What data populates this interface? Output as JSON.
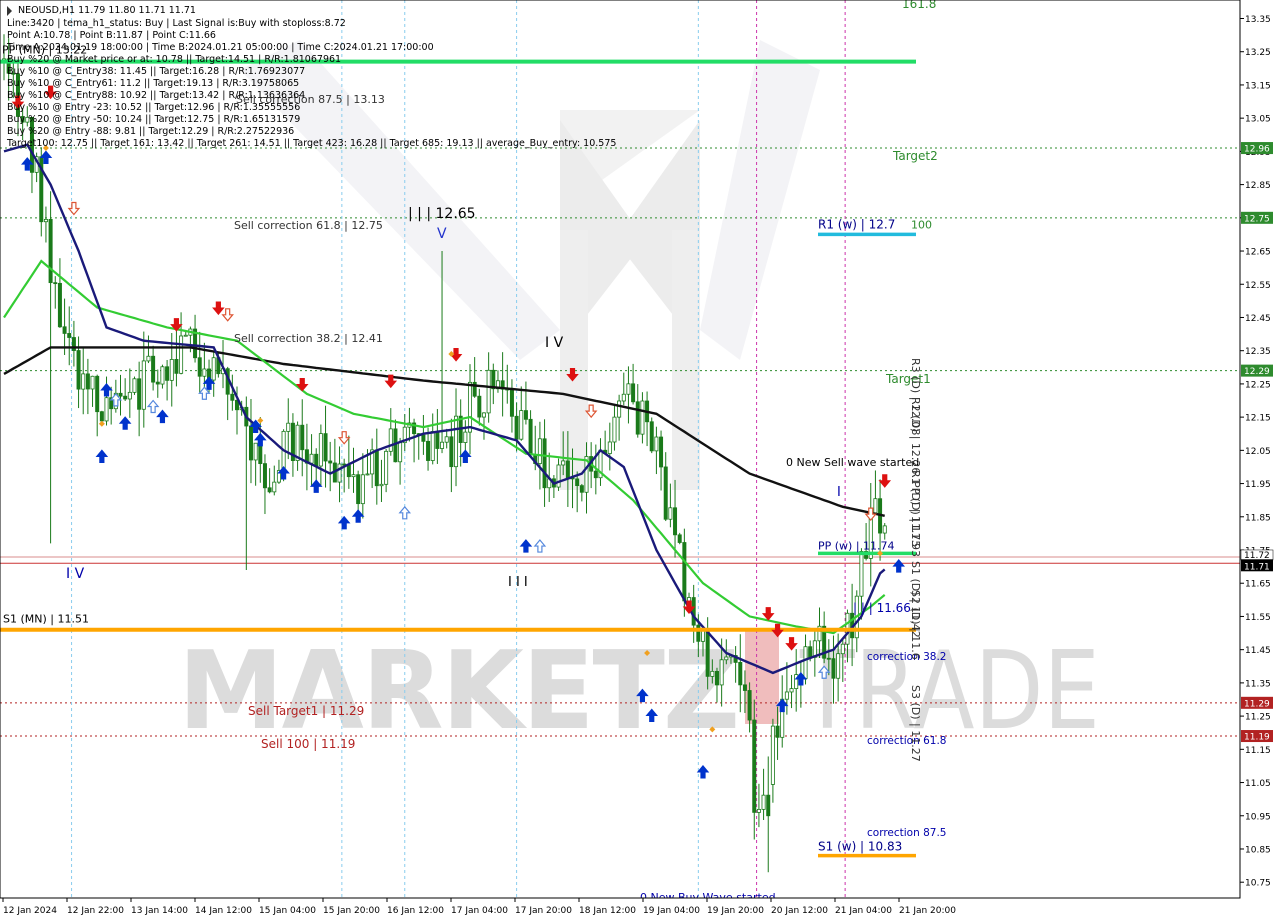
{
  "chart_data": {
    "type": "candlestick",
    "symbol_header": "NEOUSD,H1  11.79 11.80 11.71 11.71",
    "info_lines": [
      "Line:3420 | tema_h1_status: Buy | Last Signal is:Buy with stoploss:8.72",
      "Point A:10.78 | Point B:11.87 | Point C:11.66",
      "Time A:2024.01.19 18:00:00 | Time B:2024.01.21 05:00:00 | Time C:2024.01.21 17:00:00",
      "Buy %20 @ Market price or at: 10.78 || Target:14.51 | R/R:1.81067961",
      "Buy %10 @ C_Entry38: 11.45 || Target:16.28 | R/R:1.76923077",
      "Buy %10 @ C_Entry61: 11.2 || Target:19.13 | R/R:3.19758065",
      "Buy %10 @ C_Entry88: 10.92 || Target:13.42 | R/R:1.13636364",
      "Buy %10 @ Entry -23: 10.52 || Target:12.96 | R/R:1.35555556",
      "Buy %20 @ Entry -50: 10.24 || Target:12.75 | R/R:1.65131579",
      "Buy %20 @ Entry -88: 9.81 || Target:12.29 | R/R:2.27522936",
      "Target100: 12.75 || Target 161: 13.42 || Target 261: 14.51 || Target 423: 16.28 || Target 685: 19.13 || average_Buy_entry: 10.575"
    ],
    "y_range": [
      10.72,
      13.4
    ],
    "y_ticks": [
      "13.35",
      "13.25",
      "13.15",
      "13.05",
      "12.95",
      "12.85",
      "12.75",
      "12.65",
      "12.55",
      "12.45",
      "12.35",
      "12.25",
      "12.15",
      "12.05",
      "11.95",
      "11.85",
      "11.75",
      "11.65",
      "11.55",
      "11.45",
      "11.35",
      "11.25",
      "11.15",
      "11.05",
      "10.95",
      "10.85",
      "10.75"
    ],
    "x_labels": [
      "12 Jan 2024",
      "12 Jan 22:00",
      "13 Jan 14:00",
      "14 Jan 12:00",
      "15 Jan 04:00",
      "15 Jan 20:00",
      "16 Jan 12:00",
      "17 Jan 04:00",
      "17 Jan 20:00",
      "18 Jan 12:00",
      "19 Jan 04:00",
      "19 Jan 20:00",
      "20 Jan 12:00",
      "21 Jan 04:00",
      "21 Jan 20:00"
    ],
    "candle_count": 190,
    "anchor_prices": [
      [
        0,
        13.22
      ],
      [
        6,
        13.05
      ],
      [
        12,
        12.55
      ],
      [
        18,
        12.25
      ],
      [
        25,
        12.15
      ],
      [
        33,
        12.3
      ],
      [
        43,
        12.35
      ],
      [
        48,
        12.32
      ],
      [
        52,
        12.1
      ],
      [
        58,
        11.98
      ],
      [
        64,
        12.1
      ],
      [
        68,
        12.05
      ],
      [
        76,
        11.95
      ],
      [
        84,
        12.05
      ],
      [
        90,
        12.12
      ],
      [
        96,
        12.05
      ],
      [
        102,
        12.2
      ],
      [
        108,
        12.3
      ],
      [
        112,
        12.1
      ],
      [
        118,
        11.98
      ],
      [
        124,
        11.92
      ],
      [
        128,
        12.0
      ],
      [
        134,
        12.25
      ],
      [
        140,
        12.1
      ],
      [
        146,
        11.7
      ],
      [
        151,
        11.45
      ],
      [
        156,
        11.4
      ],
      [
        160,
        11.3
      ],
      [
        163,
        10.9
      ],
      [
        166,
        11.2
      ],
      [
        171,
        11.4
      ],
      [
        176,
        11.45
      ],
      [
        180,
        11.4
      ],
      [
        183,
        11.55
      ],
      [
        186,
        11.75
      ],
      [
        188,
        11.85
      ],
      [
        190,
        11.85
      ],
      [
        197,
        11.85
      ],
      [
        202,
        11.78
      ],
      [
        205,
        11.71
      ]
    ],
    "current_price": "11.71",
    "current_price_bid": "11.72",
    "highlighted_prices": [
      {
        "label": "12.96",
        "price": 12.96,
        "color": "#2e8b2e"
      },
      {
        "label": "12.75",
        "price": 12.75,
        "color": "#2e8b2e"
      },
      {
        "label": "12.29",
        "price": 12.29,
        "color": "#2e8b2e"
      },
      {
        "label": "11.29",
        "price": 11.29,
        "color": "#b22222"
      },
      {
        "label": "11.19",
        "price": 11.19,
        "color": "#b22222"
      }
    ],
    "levels": [
      {
        "label": "PP (MN) | 13.22",
        "price": 13.22,
        "color": "#22dd66"
      },
      {
        "label": "S1 (MN) | 11.51",
        "price": 11.51,
        "color": "#ffa500"
      },
      {
        "label": "R1 (w) | 12.7",
        "value_label": "100",
        "price": 12.7,
        "color": "#22bbdd"
      },
      {
        "label": "PP (w) | 11.74",
        "price": 11.74,
        "color": "#22dd66"
      },
      {
        "label": "S1 (w) | 10.83",
        "price": 10.83,
        "color": "#ffa500"
      }
    ],
    "annotations": [
      {
        "text": "Sell correction 87.5 | 13.13",
        "color": "#333333"
      },
      {
        "text": "Sell correction 61.8 | 12.75",
        "color": "#333333"
      },
      {
        "text": "Sell correction 38.2 | 12.41",
        "color": "#333333"
      },
      {
        "text": "| | | 12.65",
        "color": "#000000"
      },
      {
        "text": "V",
        "color": "#2233cc"
      },
      {
        "text": "I V",
        "color": "#000000"
      },
      {
        "text": "I V",
        "color": "#0000aa"
      },
      {
        "text": "I I I",
        "color": "#000000"
      },
      {
        "text": "Target2",
        "color": "#2e8b2e"
      },
      {
        "text": "Target1",
        "color": "#2e8b2e"
      },
      {
        "text": "161.8",
        "color": "#2e8b2e"
      },
      {
        "text": "0 New Sell wave started",
        "color": "#000000"
      },
      {
        "text": "0 New Buy Wave started",
        "color": "#0000aa"
      },
      {
        "text": "Sell Target1 | 11.29",
        "color": "#b22222"
      },
      {
        "text": "Sell 100 | 11.19",
        "color": "#b22222"
      },
      {
        "text": "correction 38.2",
        "color": "#0000aa"
      },
      {
        "text": "correction 61.8",
        "color": "#0000aa"
      },
      {
        "text": "correction 87.5",
        "color": "#0000aa"
      },
      {
        "text": "| | | 11.66",
        "color": "#0000aa"
      },
      {
        "text": "I",
        "color": "#0000aa"
      },
      {
        "text": "R3 (D) | 12.08",
        "color": "#333333"
      },
      {
        "text": "R2 (D) | 12.26",
        "color": "#333333"
      },
      {
        "text": "R1 (D) | 11.75",
        "color": "#333333"
      },
      {
        "text": "PP (D) | 11.93",
        "color": "#333333"
      },
      {
        "text": "S1 (D) | 11.42",
        "color": "#333333"
      },
      {
        "text": "S2 (D) | 11.6",
        "color": "#333333"
      },
      {
        "text": "S3 (D) | 11.27",
        "color": "#333333"
      }
    ],
    "watermark": "MARKETZITRADE",
    "colors": {
      "background": "#ffffff",
      "candle": "#1a7a1a",
      "ma_black": "#111111",
      "ma_navy": "#1a1a7a",
      "ma_green": "#33cc33",
      "price_line": "#cc3333",
      "magenta_vline": "#cc33aa",
      "sky_vline": "#88ccee"
    }
  }
}
